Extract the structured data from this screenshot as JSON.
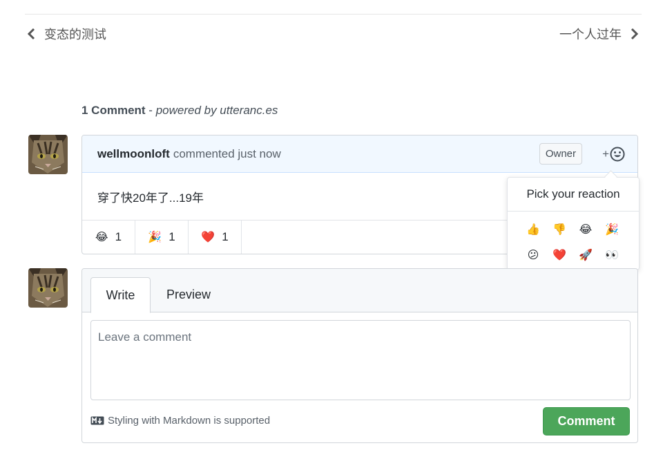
{
  "nav": {
    "prev_label": "变态的测试",
    "next_label": "一个人过年"
  },
  "comments_header": {
    "count_text": "1 Comment",
    "separator": " - ",
    "powered_text": "powered by utteranc.es"
  },
  "comment": {
    "author": "wellmoonloft",
    "action": "commented just now",
    "badge": "Owner",
    "add_reaction_plus": "+",
    "body": "穿了快20年了...19年",
    "reactions": [
      {
        "emoji": "😂",
        "count": "1"
      },
      {
        "emoji": "🎉",
        "count": "1"
      },
      {
        "emoji": "❤️",
        "count": "1"
      }
    ]
  },
  "reaction_picker": {
    "title": "Pick your reaction",
    "emojis": [
      "👍",
      "👎",
      "😂",
      "🎉",
      "😕",
      "❤️",
      "🚀",
      "👀"
    ]
  },
  "new_comment": {
    "tab_write": "Write",
    "tab_preview": "Preview",
    "placeholder": "Leave a comment",
    "markdown_note": "Styling with Markdown is supported",
    "submit_label": "Comment"
  },
  "colors": {
    "submit_green": "#4ca65a",
    "header_blue": "#f1f8ff"
  }
}
